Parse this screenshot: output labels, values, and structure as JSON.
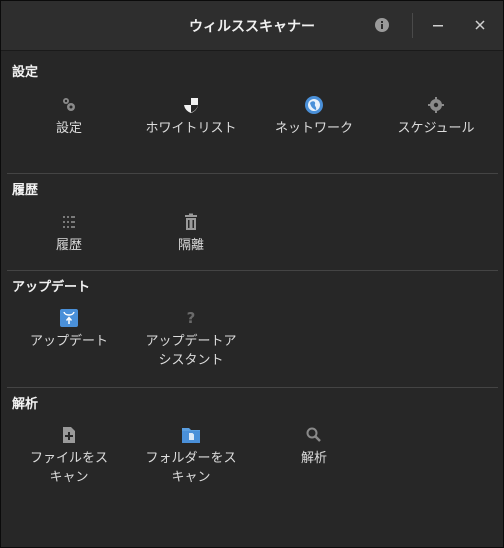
{
  "window": {
    "title": "ウィルススキャナー",
    "info_icon": "info-icon",
    "minimize_icon": "minimize-icon",
    "close_icon": "close-icon"
  },
  "sections": {
    "settings": {
      "title": "設定",
      "items": [
        {
          "label": "設定",
          "icon": "gears-icon"
        },
        {
          "label": "ホワイトリスト",
          "icon": "shield-icon"
        },
        {
          "label": "ネットワーク",
          "icon": "globe-icon"
        },
        {
          "label": "スケジュール",
          "icon": "gear-icon"
        }
      ]
    },
    "history": {
      "title": "履歴",
      "items": [
        {
          "label": "履歴",
          "icon": "history-list-icon"
        },
        {
          "label": "隔離",
          "icon": "trash-icon"
        }
      ]
    },
    "update": {
      "title": "アップデート",
      "items": [
        {
          "label": "アップデート",
          "icon": "update-icon"
        },
        {
          "label": "アップデートア\nシスタント",
          "icon": "question-icon"
        }
      ]
    },
    "analysis": {
      "title": "解析",
      "items": [
        {
          "label": "ファイルをス\nキャン",
          "icon": "file-add-icon"
        },
        {
          "label": "フォルダーをス\nキャン",
          "icon": "folder-icon"
        },
        {
          "label": "解析",
          "icon": "search-icon"
        }
      ]
    }
  },
  "colors": {
    "accent_blue": "#4a90d9",
    "icon_gray": "#8a8a8a",
    "background": "#272727"
  }
}
